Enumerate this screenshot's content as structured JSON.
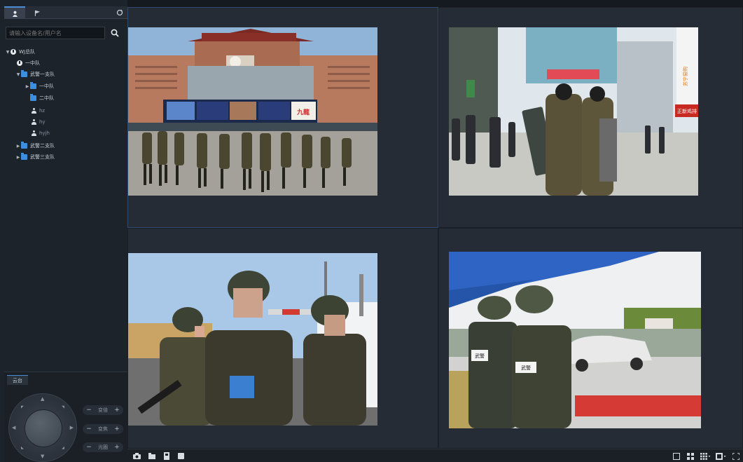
{
  "sidebar": {
    "tabs": [
      {
        "icon": "person-icon"
      },
      {
        "icon": "flag-icon"
      }
    ],
    "refresh_icon": "refresh-icon",
    "search_placeholder": "请输入设备名/用户名",
    "tree": [
      {
        "label": "WJ总队",
        "icon": "org-icon",
        "expanded": true
      },
      {
        "label": "一中队",
        "icon": "org-icon"
      },
      {
        "label": "武警一支队",
        "icon": "folder-icon",
        "expanded": true
      },
      {
        "label": "一中队",
        "icon": "folder-icon"
      },
      {
        "label": "二中队",
        "icon": "folder-icon"
      },
      {
        "label": "hz",
        "icon": "user-icon"
      },
      {
        "label": "hy",
        "icon": "user-icon"
      },
      {
        "label": "hyjh",
        "icon": "user-icon"
      },
      {
        "label": "武警二支队",
        "icon": "folder-icon"
      },
      {
        "label": "武警三支队",
        "icon": "folder-icon"
      }
    ]
  },
  "ptz": {
    "tab_label": "云台",
    "controls": [
      {
        "label": "变倍"
      },
      {
        "label": "变焦"
      },
      {
        "label": "光圈"
      }
    ]
  },
  "video": {
    "panes": [
      {
        "scene": "troops-marching-at-railway-station"
      },
      {
        "scene": "armed-patrol-on-shopping-street"
      },
      {
        "scene": "three-soldiers-in-helmets"
      },
      {
        "scene": "checkpoint-under-blue-canopy"
      }
    ],
    "feed_text": {
      "station_sign": "九龍",
      "mall_brand": "苏宁易购",
      "shop_sign": "正新鸡排",
      "vest_label_left": "武警",
      "vest_label_right": "武警"
    }
  },
  "toolbar": {
    "left_icons": [
      "snapshot-icon",
      "folder-icon",
      "record-icon",
      "stop-icon"
    ],
    "right_icons": [
      "layout-1-icon",
      "layout-4-icon",
      "layout-9-icon",
      "layout-more-icon",
      "fullscreen-icon"
    ]
  },
  "colors": {
    "accent": "#4a8dd4",
    "panel": "#1d232b",
    "video_bg": "#252c35"
  }
}
